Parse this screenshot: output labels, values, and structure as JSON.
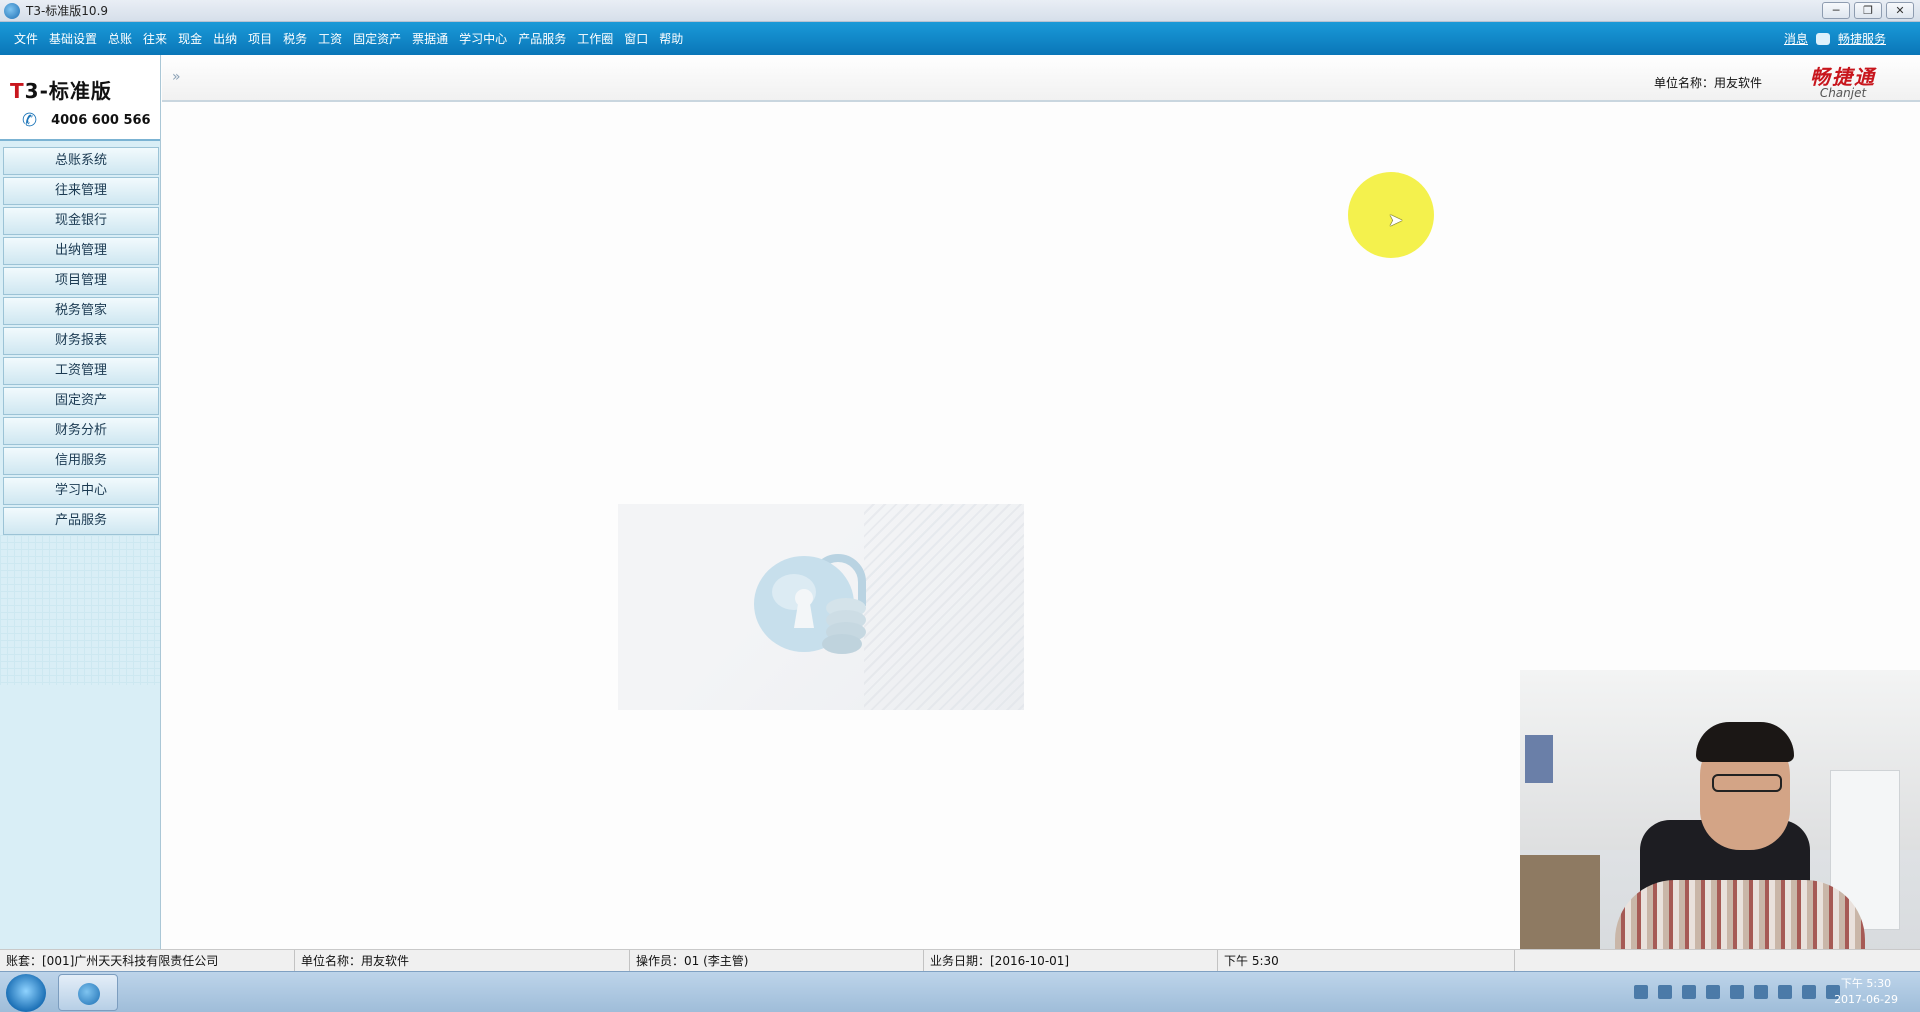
{
  "window": {
    "title": "T3-标准版10.9",
    "controls": [
      "─",
      "❐",
      "✕"
    ]
  },
  "menu": {
    "items": [
      "文件",
      "基础设置",
      "总账",
      "往来",
      "现金",
      "出纳",
      "项目",
      "税务",
      "工资",
      "固定资产",
      "票据通",
      "学习中心",
      "产品服务",
      "工作圈",
      "窗口",
      "帮助"
    ],
    "message_link": "消息",
    "service_link": "畅捷服务"
  },
  "sidebar": {
    "logo_prefix": "T",
    "logo_suffix": "3-标准版",
    "phone": "4006 600 566",
    "items": [
      "总账系统",
      "往来管理",
      "现金银行",
      "出纳管理",
      "项目管理",
      "税务管家",
      "财务报表",
      "工资管理",
      "固定资产",
      "财务分析",
      "信用服务",
      "学习中心",
      "产品服务"
    ]
  },
  "header": {
    "collapse_glyph": "»",
    "unit_label": "单位名称：用友软件",
    "brand_cn": "畅捷通",
    "brand_en": "Chanjet"
  },
  "statusbar": {
    "account": "账套：[001]广州天天科技有限责任公司",
    "unit": "单位名称：用友软件",
    "operator": "操作员：01 (李主管)",
    "business_date": "业务日期：[2016-10-01]",
    "time": "下午 5:30"
  },
  "taskbar": {
    "clock_time": "下午 5:30",
    "clock_date": "2017-06-29"
  },
  "colors": {
    "menubar": "#0f86c8",
    "sidebar_bg": "#d9eef6",
    "brand_red": "#c8161d",
    "cursor_highlight": "#f3ef3a"
  },
  "icons": [
    "app-icon",
    "phone-icon",
    "lock-coins-icon",
    "start-orb-icon",
    "message-icon"
  ]
}
